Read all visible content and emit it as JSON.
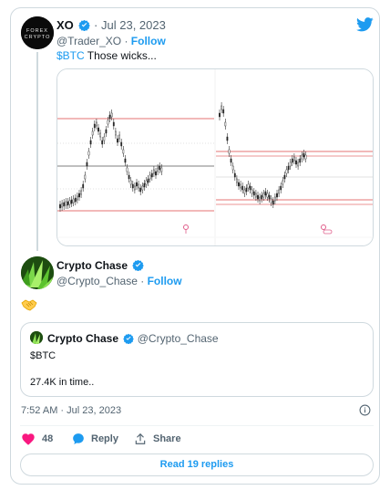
{
  "tweet": {
    "author_name": "XO",
    "author_handle": "@Trader_XO",
    "date": "Jul 23, 2023",
    "separator": "·",
    "follow_label": "Follow",
    "text_cashtag": "$BTC",
    "text_body": " Those wicks...",
    "avatar_text_top": "FOREX",
    "avatar_text_bottom": "CRYPTO"
  },
  "reply": {
    "author_name": "Crypto Chase",
    "author_handle": "@Crypto_Chase",
    "separator": "·",
    "follow_label": "Follow",
    "emoji": "handshake"
  },
  "quote": {
    "author_name": "Crypto Chase",
    "author_handle": "@Crypto_Chase",
    "line1": "$BTC",
    "line2": "27.4K in time.."
  },
  "footer": {
    "timestamp": "7:52 AM · Jul 23, 2023",
    "likes": "48",
    "reply_label": "Reply",
    "share_label": "Share",
    "read_replies": "Read 19 replies"
  },
  "colors": {
    "accent": "#1d9bf0",
    "like": "#f91880",
    "muted": "#536471",
    "border": "#cfd9de"
  }
}
